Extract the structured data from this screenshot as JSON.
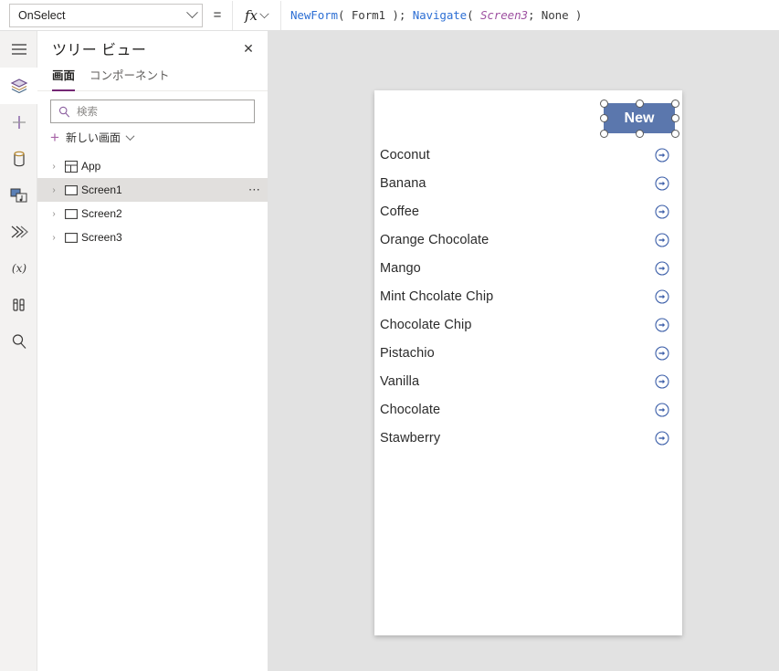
{
  "formula_bar": {
    "property": "OnSelect",
    "equals": "=",
    "fx_label": "fx",
    "formula_parts": [
      {
        "t": "NewForm",
        "k": "fn"
      },
      {
        "t": "( ",
        "k": "pun"
      },
      {
        "t": "Form1",
        "k": "id"
      },
      {
        "t": " ); ",
        "k": "pun"
      },
      {
        "t": "Navigate",
        "k": "fn"
      },
      {
        "t": "( ",
        "k": "pun"
      },
      {
        "t": "Screen3",
        "k": "scr"
      },
      {
        "t": "; ",
        "k": "pun"
      },
      {
        "t": "None",
        "k": "id"
      },
      {
        "t": " )",
        "k": "pun"
      }
    ]
  },
  "rail": {
    "items": [
      {
        "icon": "hamburger-menu-icon",
        "name": "menu",
        "active": false
      },
      {
        "icon": "layers-icon",
        "name": "tree-view",
        "active": true
      },
      {
        "icon": "plus-icon",
        "name": "insert",
        "active": false
      },
      {
        "icon": "database-icon",
        "name": "data",
        "active": false
      },
      {
        "icon": "media-icon",
        "name": "media",
        "active": false
      },
      {
        "icon": "flow-icon",
        "name": "power-automate",
        "active": false
      },
      {
        "icon": "variables-icon",
        "name": "variables",
        "active": false
      },
      {
        "icon": "tools-icon",
        "name": "tools",
        "active": false
      },
      {
        "icon": "search-icon",
        "name": "search",
        "active": false
      }
    ]
  },
  "tree_panel": {
    "title": "ツリー ビュー",
    "close_label": "✕",
    "tabs": [
      {
        "label": "画面",
        "active": true
      },
      {
        "label": "コンポーネント",
        "active": false
      }
    ],
    "search_placeholder": "検索",
    "new_screen_label": "新しい画面",
    "items": [
      {
        "label": "App",
        "icon": "app-icon",
        "selected": false,
        "has_menu": false
      },
      {
        "label": "Screen1",
        "icon": "screen-icon",
        "selected": true,
        "has_menu": true
      },
      {
        "label": "Screen2",
        "icon": "screen-icon",
        "selected": false,
        "has_menu": false
      },
      {
        "label": "Screen3",
        "icon": "screen-icon",
        "selected": false,
        "has_menu": false
      }
    ],
    "overflow_label": "⋯",
    "expand_glyph": "›"
  },
  "canvas": {
    "new_button": {
      "label": "New",
      "color": "#5b77ad",
      "text_color": "#ffffff",
      "selected": true
    },
    "gallery_items": [
      "Coconut",
      "Banana",
      "Coffee",
      "Orange Chocolate",
      "Mango",
      "Mint Chcolate Chip",
      "Chocolate Chip",
      "Pistachio",
      "Vanilla",
      "Chocolate",
      "Stawberry"
    ],
    "arrow_icon": "next-arrow-icon",
    "arrow_color": "#3b5ea8"
  },
  "theme": {
    "accent": "#742774",
    "rail_bg": "#f3f2f1",
    "canvas_bg": "#e2e2e2",
    "selected_row": "#e1dfdd"
  }
}
